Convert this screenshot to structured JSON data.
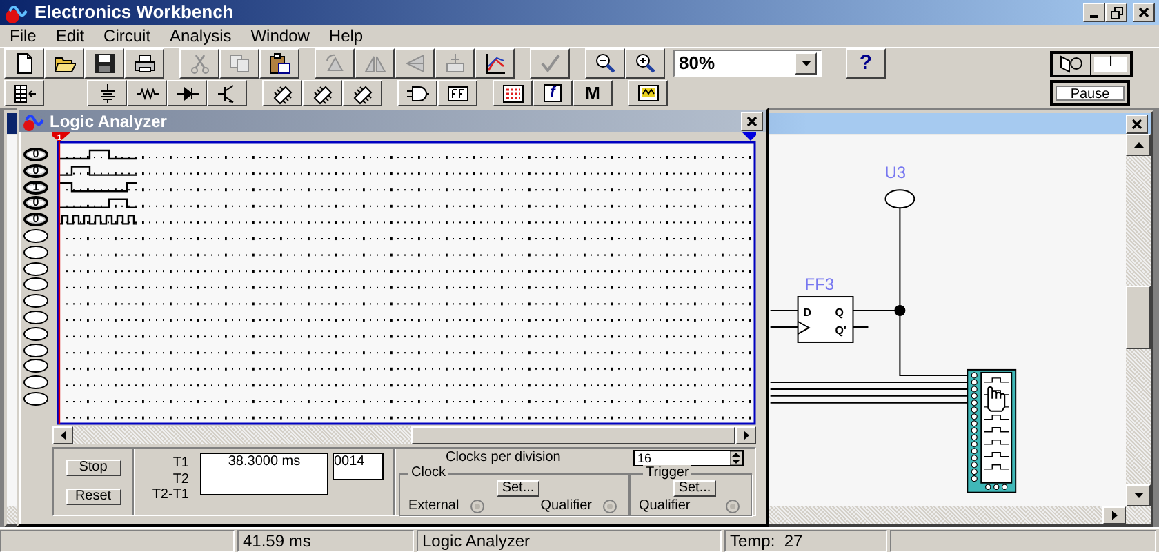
{
  "window": {
    "title": "Electronics Workbench"
  },
  "menu": [
    {
      "label": "File"
    },
    {
      "label": "Edit"
    },
    {
      "label": "Circuit"
    },
    {
      "label": "Analysis"
    },
    {
      "label": "Window"
    },
    {
      "label": "Help"
    }
  ],
  "toolbar": {
    "zoom": "80%",
    "help": "?",
    "power_switch": {
      "label": "I",
      "on": false
    }
  },
  "parts_bar": {
    "controls": "f",
    "misc": "M",
    "pause": "Pause"
  },
  "logic_analyzer": {
    "title": "Logic Analyzer",
    "cursor": "1",
    "channels": [
      {
        "active": true,
        "value": "0"
      },
      {
        "active": true,
        "value": "0"
      },
      {
        "active": true,
        "value": "1"
      },
      {
        "active": true,
        "value": "0"
      },
      {
        "active": true,
        "value": "0"
      },
      {
        "active": false
      },
      {
        "active": false
      },
      {
        "active": false
      },
      {
        "active": false
      },
      {
        "active": false
      },
      {
        "active": false
      },
      {
        "active": false
      },
      {
        "active": false
      },
      {
        "active": false
      },
      {
        "active": false
      },
      {
        "active": false
      }
    ],
    "buttons": [
      "Stop",
      "Reset"
    ],
    "time_labels": [
      "T1",
      "T2",
      "T2-T1"
    ],
    "time_readings": [
      "38.3000 ms"
    ],
    "count": "0014",
    "clocks_per_division": {
      "label": "Clocks per division",
      "value": "16"
    },
    "clock": {
      "title": "Clock",
      "set": "Set...",
      "external": "External",
      "external_selected": false,
      "qualifier": "Qualifier",
      "qualifier_selected": false
    },
    "trigger": {
      "title": "Trigger",
      "set": "Set...",
      "qualifier": "Qualifier",
      "qualifier_selected": false
    }
  },
  "circuit": {
    "probe_label": "U3",
    "flip_flop": {
      "label": "FF3",
      "pins": [
        "D",
        "Q",
        "Q'"
      ]
    }
  },
  "status_bar": {
    "time": "41.59 ms",
    "instrument": "Logic Analyzer",
    "temperature": "Temp:  27"
  }
}
